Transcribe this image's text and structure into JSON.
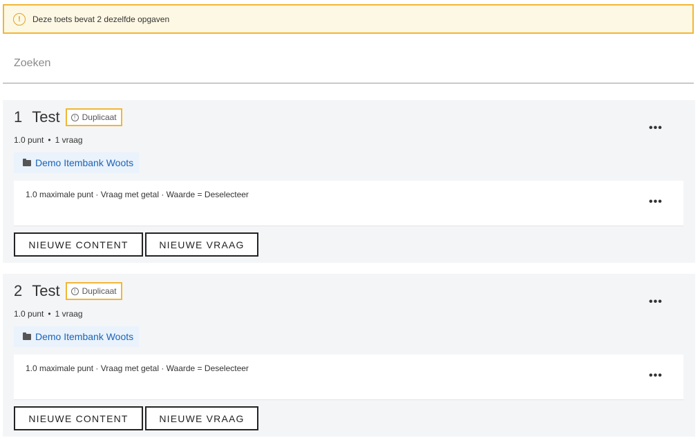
{
  "warning": {
    "icon": "exclamation-circle-icon",
    "text": "Deze toets bevat 2 dezelfde opgaven"
  },
  "search": {
    "placeholder": "Zoeken",
    "value": ""
  },
  "questions": [
    {
      "number": "1",
      "title": "Test",
      "badge": "Duplicaat",
      "points": "1.0 punt",
      "separator": "•",
      "count": "1 vraag",
      "folder": "Demo Itembank Woots",
      "item": "1.0 maximale punt · Vraag met getal · Waarde = Deselecteer",
      "more": "•••",
      "buttons": {
        "content": "NIEUWE CONTENT",
        "question": "NIEUWE VRAAG"
      }
    },
    {
      "number": "2",
      "title": "Test",
      "badge": "Duplicaat",
      "points": "1.0 punt",
      "separator": "•",
      "count": "1 vraag",
      "folder": "Demo Itembank Woots",
      "item": "1.0 maximale punt · Vraag met getal · Waarde = Deselecteer",
      "more": "•••",
      "buttons": {
        "content": "NIEUWE CONTENT",
        "question": "NIEUWE VRAAG"
      }
    }
  ],
  "colors": {
    "warning_border": "#f2b634",
    "warning_bg": "#fdf8e4",
    "card_bg": "#f4f5f7",
    "link": "#1a63b8"
  }
}
